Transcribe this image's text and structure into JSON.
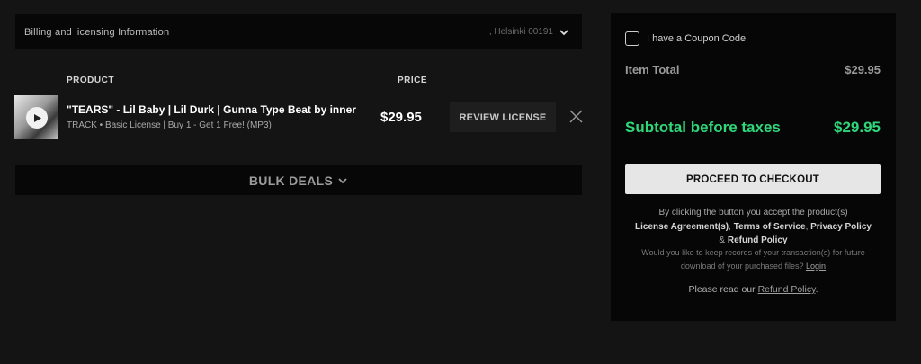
{
  "billing": {
    "title": "Billing and licensing Information",
    "location": ", Helsinki 00191"
  },
  "table": {
    "product_header": "PRODUCT",
    "price_header": "PRICE"
  },
  "item": {
    "title": "\"TEARS\" - Lil Baby | Lil Durk | Gunna Type Beat by inner",
    "subtitle": "TRACK • Basic License | Buy 1 - Get 1 Free! (MP3)",
    "price": "$29.95",
    "review_label": "REVIEW LICENSE"
  },
  "bulk": {
    "label": "BULK DEALS"
  },
  "summary": {
    "coupon_label": "I have a Coupon Code",
    "item_total_label": "Item Total",
    "item_total_value": "$29.95",
    "subtotal_label": "Subtotal before taxes",
    "subtotal_value": "$29.95",
    "checkout_label": "PROCEED TO CHECKOUT",
    "legal_prefix": "By clicking the button you accept the product(s)",
    "legal_license": "License Agreement(s)",
    "legal_sep1": ", ",
    "legal_terms": "Terms of Service",
    "legal_sep2": ", ",
    "legal_privacy": "Privacy Policy",
    "legal_and": "&",
    "legal_refund": "Refund Policy",
    "records_text": "Would you like to keep records of your transaction(s) for future download of your purchased files?",
    "login_link": "Login",
    "refund_prefix": "Please read our",
    "refund_link": "Refund Policy",
    "refund_suffix": "."
  },
  "colors": {
    "accent_green": "#2fd779",
    "background": "#141414",
    "panel": "#060606"
  }
}
